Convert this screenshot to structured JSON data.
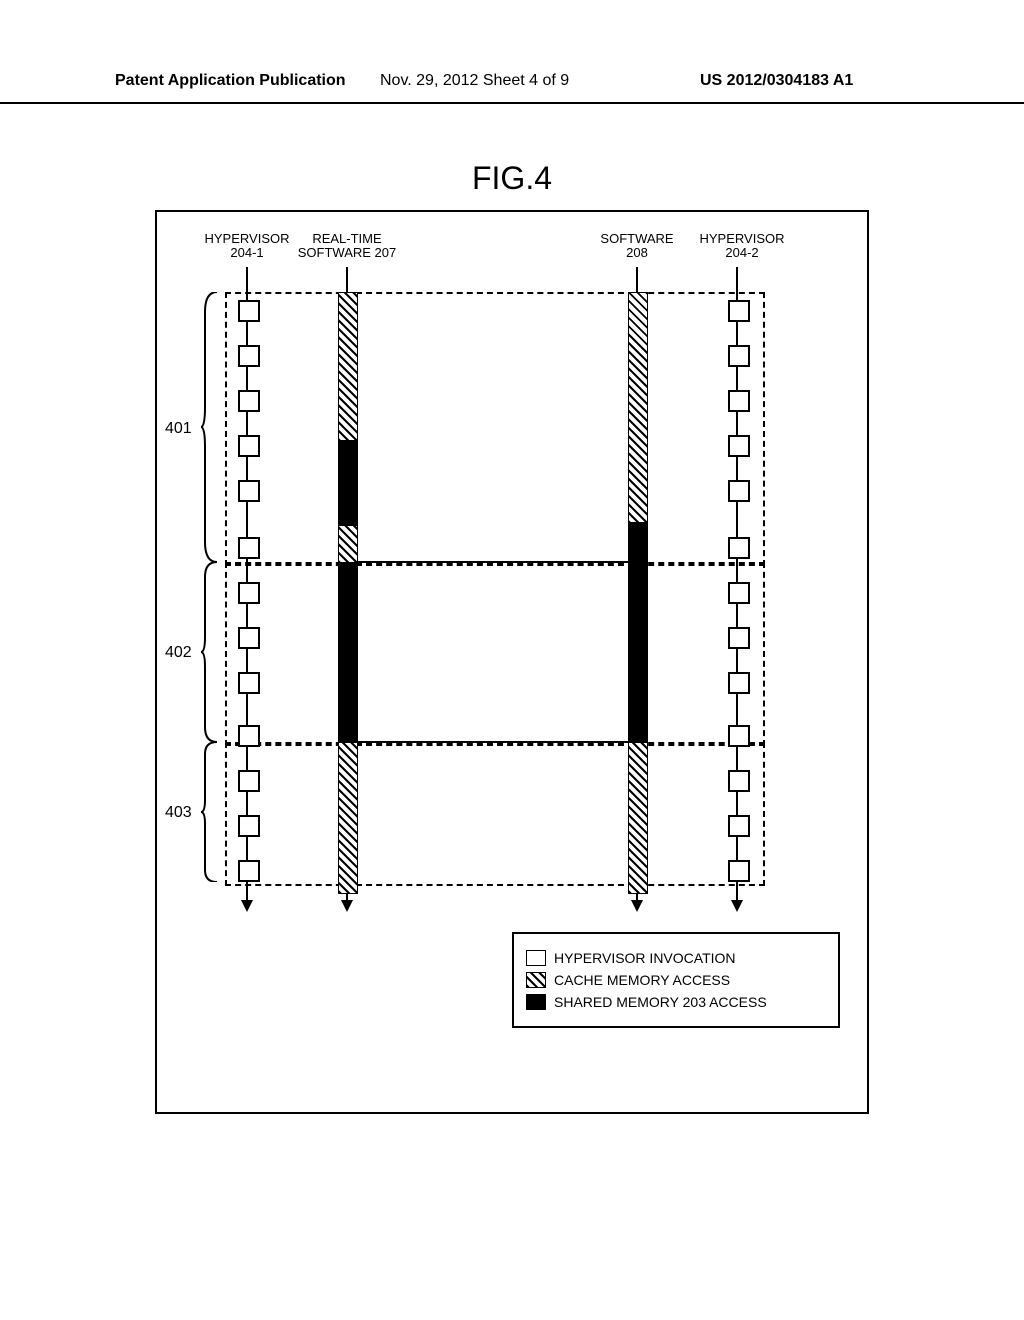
{
  "header": {
    "left": "Patent Application Publication",
    "mid": "Nov. 29, 2012  Sheet 4 of 9",
    "right": "US 2012/0304183 A1"
  },
  "figure_title": "FIG.4",
  "columns": {
    "hyp1": {
      "line1": "HYPERVISOR",
      "line2": "204-1"
    },
    "rtsw": {
      "line1": "REAL-TIME",
      "line2": "SOFTWARE 207"
    },
    "sw": {
      "line1": "SOFTWARE",
      "line2": "208"
    },
    "hyp2": {
      "line1": "HYPERVISOR",
      "line2": "204-2"
    }
  },
  "regions": {
    "r401": "401",
    "r402": "402",
    "r403": "403"
  },
  "legend": {
    "hollow": "HYPERVISOR INVOCATION",
    "hatch": "CACHE MEMORY ACCESS",
    "solid": "SHARED MEMORY 203 ACCESS"
  },
  "chart_data": {
    "type": "table",
    "description": "Timing diagram with four lanes. Hypervisor lanes 204-1 and 204-2 show periodic invocation ticks. Software lanes 207 and 208 alternate between cache memory access (hatched) and shared memory 203 access (solid). Three dashed regions 401, 402, 403 group time intervals.",
    "lanes": [
      "HYPERVISOR 204-1",
      "REAL-TIME SOFTWARE 207",
      "SOFTWARE 208",
      "HYPERVISOR 204-2"
    ],
    "hypervisor_ticks_204_1": 13,
    "hypervisor_ticks_204_2": 13,
    "software_207_segments": [
      {
        "region": "401",
        "type": "cache",
        "approx_fraction": 0.55
      },
      {
        "region": "401",
        "type": "shared",
        "approx_fraction": 0.45
      },
      {
        "region": "402",
        "type": "shared",
        "approx_fraction": 1.0
      },
      {
        "region": "403",
        "type": "cache",
        "approx_fraction": 1.0
      }
    ],
    "software_208_segments": [
      {
        "region": "401",
        "type": "cache",
        "approx_fraction": 0.85
      },
      {
        "region": "401",
        "type": "shared",
        "approx_fraction": 0.15
      },
      {
        "region": "402",
        "type": "shared",
        "approx_fraction": 1.0
      },
      {
        "region": "403",
        "type": "cache",
        "approx_fraction": 1.0
      }
    ],
    "regions": [
      {
        "id": "401",
        "ticks": 6
      },
      {
        "id": "402",
        "ticks": 4
      },
      {
        "id": "403",
        "ticks": 3
      }
    ],
    "sync_lines_between_207_208": 2
  }
}
